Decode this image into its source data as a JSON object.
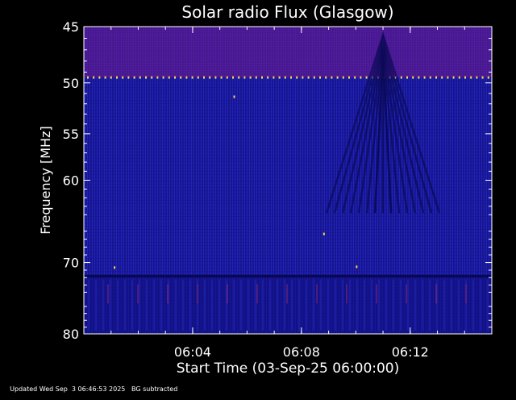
{
  "chart_data": {
    "type": "heatmap",
    "title": "Solar radio Flux (Glasgow)",
    "xlabel": "Start Time (03-Sep-25 06:00:00)",
    "ylabel": "Frequency [MHz]",
    "x_unit": "minutes after 06:00:00",
    "xlim": [
      0,
      15
    ],
    "ylim": [
      45,
      80
    ],
    "y_scale": "log",
    "x_ticks": [
      {
        "value": 4,
        "label": "06:04"
      },
      {
        "value": 8,
        "label": "06:08"
      },
      {
        "value": 12,
        "label": "06:12"
      }
    ],
    "y_ticks": [
      {
        "value": 45,
        "label": "45"
      },
      {
        "value": 50,
        "label": "50"
      },
      {
        "value": 55,
        "label": "55"
      },
      {
        "value": 60,
        "label": "60"
      },
      {
        "value": 70,
        "label": "70"
      },
      {
        "value": 80,
        "label": "80"
      }
    ],
    "colors": {
      "background": "#000000",
      "plot_base": "#1a1a9e",
      "interference_band": "#7a1f8f",
      "hot_pixel": "#ffd24a",
      "text": "#ffffff"
    },
    "features": [
      {
        "name": "interference band",
        "freq_range": [
          45,
          49.5
        ]
      },
      {
        "name": "persistent carrier",
        "freq": 49.5
      },
      {
        "name": "chevron interference pattern",
        "time": 11
      }
    ]
  },
  "footer": {
    "updated": "Updated Wed Sep  3 06:46:53 2025",
    "note": "BG subtracted"
  }
}
